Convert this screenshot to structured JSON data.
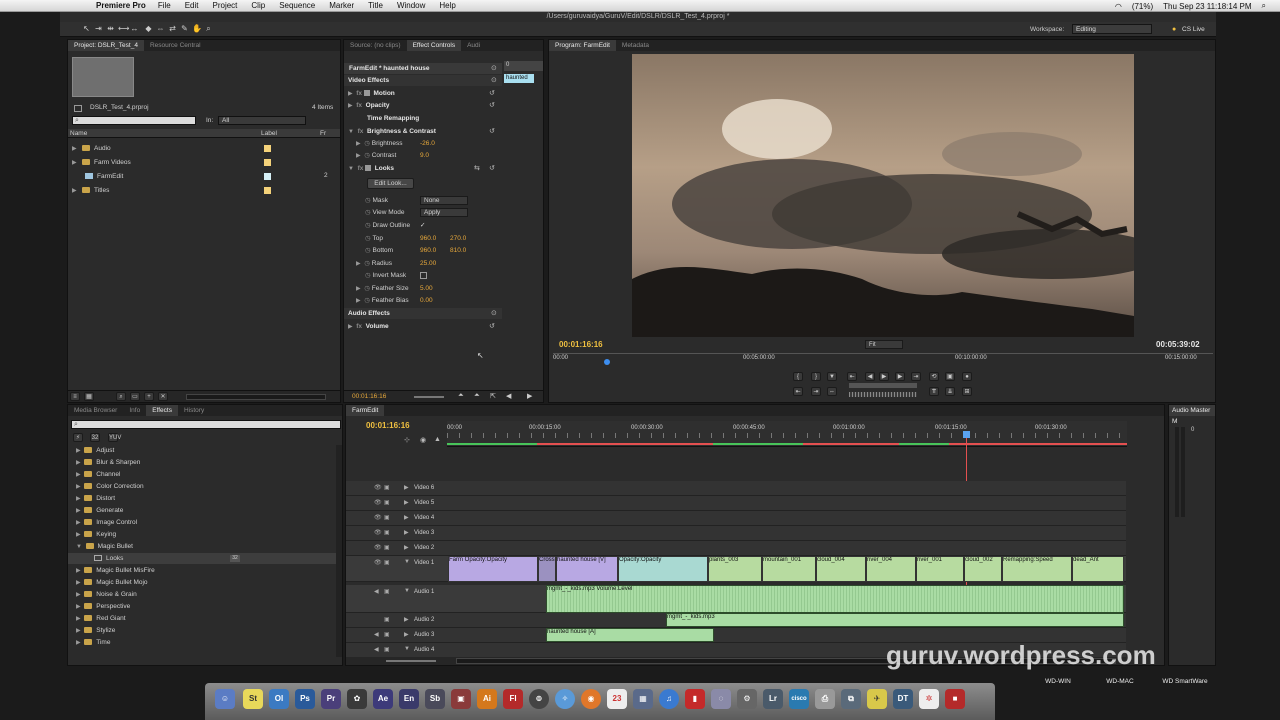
{
  "menubar": {
    "app": "Premiere Pro",
    "items": [
      "File",
      "Edit",
      "Project",
      "Clip",
      "Sequence",
      "Marker",
      "Title",
      "Window",
      "Help"
    ],
    "battery": "(71%)",
    "clock": "Thu Sep 23  11:18:14 PM"
  },
  "window": {
    "title": "/Users/guruvaidya/GuruV/Edit/DSLR/DSLR_Test_4.prproj *"
  },
  "workspace": {
    "label": "Workspace:",
    "value": "Editing",
    "cslive": "CS Live"
  },
  "project": {
    "tabs": [
      "Project: DSLR_Test_4",
      "Resource Central"
    ],
    "filename": "DSLR_Test_4.prproj",
    "count": "4 Items",
    "in_label": "In:",
    "in_value": "All",
    "col_name": "Name",
    "col_label": "Label",
    "col_fr": "Fr",
    "items": [
      {
        "name": "Audio",
        "color": "#f4d27a"
      },
      {
        "name": "Farm Videos",
        "color": "#f4d27a"
      },
      {
        "name": "FarmEdit",
        "color": "#d6f0f6",
        "extra": "2"
      },
      {
        "name": "Titles",
        "color": "#f4d27a"
      }
    ]
  },
  "effect_controls": {
    "tabs": [
      "Source: (no clips)",
      "Effect Controls",
      "Audi"
    ],
    "header": "FarmEdit * haunted house",
    "mini_clip": "haunted",
    "mini_time": "0",
    "video_effects": "Video Effects",
    "motion": "Motion",
    "opacity": "Opacity",
    "time_remap": "Time Remapping",
    "bc": "Brightness & Contrast",
    "brightness_label": "Brightness",
    "brightness_value": "-26.0",
    "contrast_label": "Contrast",
    "contrast_value": "9.0",
    "looks": "Looks",
    "edit_look": "Edit Look...",
    "mask_label": "Mask",
    "mask_value": "None",
    "viewmode_label": "View Mode",
    "viewmode_value": "Apply",
    "outline_label": "Draw Outline",
    "outline_check": "✓",
    "top_label": "Top",
    "top_x": "960.0",
    "top_y": "270.0",
    "bottom_label": "Bottom",
    "bottom_x": "960.0",
    "bottom_y": "810.0",
    "radius_label": "Radius",
    "radius_value": "25.00",
    "invert_label": "Invert Mask",
    "feather_size_label": "Feather Size",
    "feather_size_value": "5.00",
    "feather_bias_label": "Feather Bias",
    "feather_bias_value": "0.00",
    "audio_effects": "Audio Effects",
    "volume": "Volume",
    "timecode": "00:01:16:16"
  },
  "program": {
    "tabs": [
      "Program: FarmEdit",
      "Metadata"
    ],
    "current_time": "00:01:16:16",
    "duration": "00:05:39:02",
    "fit": "Fit",
    "ruler": [
      "00:00",
      "00:05:00:00",
      "00:10:00:00",
      "00:15:00:00"
    ]
  },
  "effects_panel": {
    "tabs": [
      "Media Browser",
      "Info",
      "Effects",
      "History"
    ],
    "items": [
      "Adjust",
      "Blur & Sharpen",
      "Channel",
      "Color Correction",
      "Distort",
      "Generate",
      "Image Control",
      "Keying",
      "Magic Bullet",
      "Looks",
      "Magic Bullet MisFire",
      "Magic Bullet Mojo",
      "Noise & Grain",
      "Perspective",
      "Red Giant",
      "Stylize",
      "Time"
    ],
    "looks_badge": "32"
  },
  "timeline": {
    "tab": "FarmEdit",
    "current_time": "00:01:16:16",
    "ruler": [
      "00:00",
      "00:00:15:00",
      "00:00:30:00",
      "00:00:45:00",
      "00:01:00:00",
      "00:01:15:00",
      "00:01:30:00"
    ],
    "video_tracks": [
      "Video 6",
      "Video 5",
      "Video 4",
      "Video 3",
      "Video 2",
      "Video 1"
    ],
    "audio_tracks": [
      "Audio 1",
      "Audio 2",
      "Audio 3",
      "Audio 4"
    ],
    "v1_clips": [
      "Farm Opacity:Opacity",
      "Cross",
      "haunted house [V]",
      "Opacity:Opacity",
      "plants_003",
      "mountain_001",
      "cloud_004",
      "river_004",
      "river_001",
      "cloud_002",
      "Remapping:Speed",
      "dead_Ant"
    ],
    "a1_clip": "mgmt_-_kids.mp3  Volume:Level",
    "a2_clip": "mgmt_-_kids.mp3",
    "a3_clip": "haunted house [A]"
  },
  "audio_master": {
    "title": "Audio Master M",
    "zero": "0"
  },
  "watermark": "guruv.wordpress.com",
  "desktop": {
    "drive1": "WD-WIN",
    "drive2": "WD-MAC",
    "drive3": "WD SmartWare"
  },
  "dock_icons": [
    "Ps",
    "Pr",
    "Ae",
    "En",
    "Sb",
    "Ai",
    "Fl",
    "Lr",
    "DT"
  ]
}
